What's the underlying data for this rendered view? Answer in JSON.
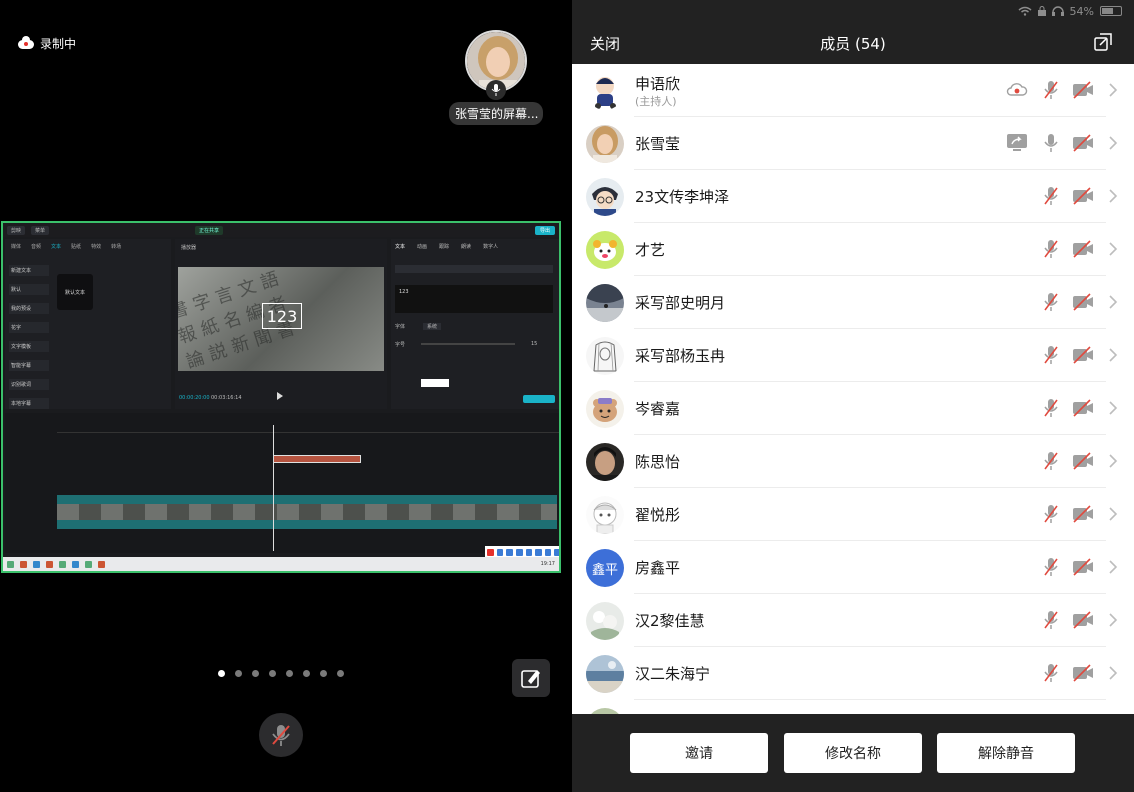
{
  "stage": {
    "recording_label": "录制中",
    "speaker_name": "张雪莹的屏幕...",
    "shared_screen": {
      "overlay_number": "123",
      "editor_tabs": [
        "媒体",
        "音频",
        "文本",
        "贴纸",
        "特效",
        "转场"
      ],
      "editor_sidebar": [
        "新建文本",
        "默认",
        "我的预设",
        "花字",
        "文字模板",
        "智能字幕",
        "识别歌词",
        "本地字幕"
      ],
      "default_text_card": "默认文本",
      "player_label": "播放器",
      "right_tabs": [
        "文本",
        "动画",
        "跟踪",
        "朗读",
        "数字人"
      ],
      "text_value": "123",
      "font_label": "字体",
      "font_value": "系统",
      "size_label": "字号",
      "size_value": "15",
      "time_current": "00:00:20:00",
      "time_total": "00:03:16:14",
      "clock": "19:17"
    },
    "pages": 8,
    "active_page": 0
  },
  "panel": {
    "status": {
      "battery": "54%"
    },
    "header": {
      "close_label": "关闭",
      "title": "成员 (54)"
    },
    "members": [
      {
        "name": "申语欣",
        "role": "(主持人)",
        "avatar": "cartoon-boy",
        "cloud_record": true,
        "share": false,
        "mic": "muted",
        "cam": "off"
      },
      {
        "name": "张雪莹",
        "avatar": "photo-woman",
        "share": true,
        "mic": "on",
        "cam": "off"
      },
      {
        "name": "23文传李坤泽",
        "avatar": "anime-detective",
        "mic": "muted",
        "cam": "off"
      },
      {
        "name": "才艺",
        "avatar": "cartoon-dog",
        "mic": "muted",
        "cam": "off"
      },
      {
        "name": "采写部史明月",
        "avatar": "photo-cave",
        "mic": "muted",
        "cam": "off"
      },
      {
        "name": "采写部杨玉冉",
        "avatar": "sketch-girl",
        "mic": "muted",
        "cam": "off"
      },
      {
        "name": "岑睿嘉",
        "avatar": "cartoon-bear",
        "mic": "muted",
        "cam": "off"
      },
      {
        "name": "陈思怡",
        "avatar": "photo-dark",
        "mic": "muted",
        "cam": "off"
      },
      {
        "name": "翟悦彤",
        "avatar": "sketch-chibi",
        "mic": "muted",
        "cam": "off"
      },
      {
        "name": "房鑫平",
        "avatar_text": "鑫平",
        "avatar": "initials",
        "mic": "muted",
        "cam": "off"
      },
      {
        "name": "汉2黎佳慧",
        "avatar": "photo-flowers",
        "mic": "muted",
        "cam": "off"
      },
      {
        "name": "汉二朱海宁",
        "avatar": "photo-sea",
        "mic": "muted",
        "cam": "off"
      }
    ],
    "footer": {
      "invite_label": "邀请",
      "rename_label": "修改名称",
      "unmute_label": "解除静音"
    },
    "colors": {
      "header_bg": "#222222",
      "muted_red": "#e04a3f",
      "icon_gray": "#a0a0a0",
      "avatar_blue": "#3d6fd8"
    }
  }
}
